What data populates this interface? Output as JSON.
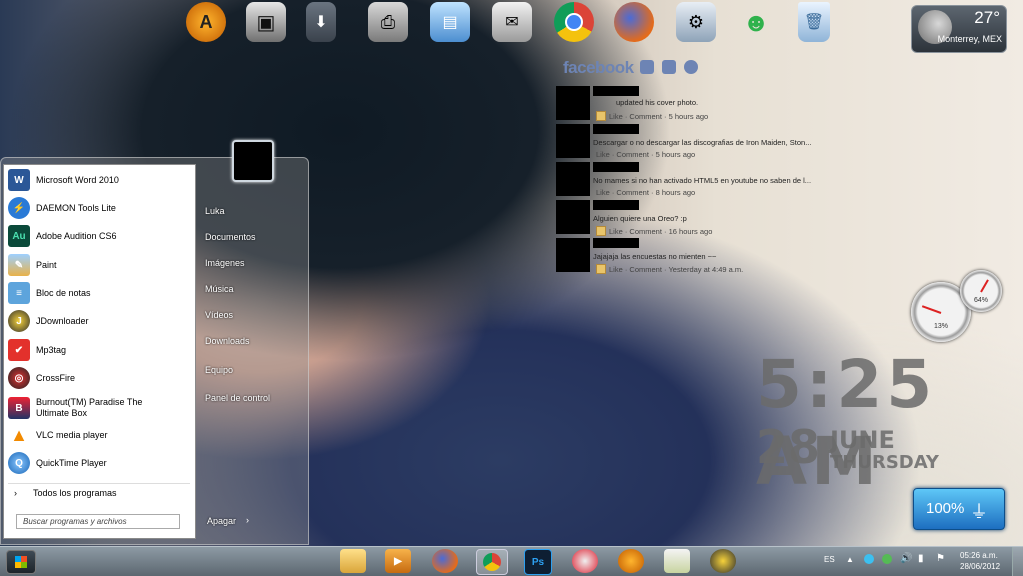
{
  "dock": {
    "icons": [
      "aimp-icon",
      "media-center-icon",
      "downloads-icon",
      "printer-icon",
      "photo-viewer-icon",
      "mail-icon",
      "chrome-icon",
      "firefox-icon",
      "control-panel-icon",
      "messenger-icon",
      "recycle-bin-icon"
    ]
  },
  "weather": {
    "temperature": "27°",
    "city": "Monterrey, MEX"
  },
  "facebook": {
    "title": "facebook",
    "feed": [
      {
        "text": "updated his cover photo.",
        "meta": "Like · Comment · 5 hours ago"
      },
      {
        "text": "Descargar o no descargar las discografias de Iron Maiden, Ston...",
        "meta": "Like · Comment · 5 hours ago"
      },
      {
        "text": "No mames si no han activado HTML5 en youtube no saben de l...",
        "meta": "Like · Comment · 8 hours ago"
      },
      {
        "text": "Alguien quiere una Oreo? :p",
        "meta": "Like · Comment · 16 hours ago"
      },
      {
        "text": "Jajajaja las encuestas no mienten ~~",
        "meta": "Like · Comment · Yesterday at 4:49 a.m."
      }
    ]
  },
  "gauges": {
    "cpu": "13%",
    "memory": "64%"
  },
  "clock": {
    "time": "5:25 AM",
    "day": "28",
    "month": "JUNE",
    "weekday": "THURSDAY"
  },
  "battery": {
    "percent": "100%"
  },
  "start_menu": {
    "programs": [
      {
        "label": "Microsoft Word 2010",
        "icon": "word-icon",
        "glyph": "W"
      },
      {
        "label": "DAEMON Tools Lite",
        "icon": "daemon-tools-icon",
        "glyph": "⚡"
      },
      {
        "label": "Adobe Audition CS6",
        "icon": "audition-icon",
        "glyph": "Au"
      },
      {
        "label": "Paint",
        "icon": "paint-icon",
        "glyph": "✎"
      },
      {
        "label": "Bloc de notas",
        "icon": "notepad-icon",
        "glyph": "≡"
      },
      {
        "label": "JDownloader",
        "icon": "jdownloader-icon",
        "glyph": "J"
      },
      {
        "label": "Mp3tag",
        "icon": "mp3tag-icon",
        "glyph": "✔"
      },
      {
        "label": "CrossFire",
        "icon": "crossfire-icon",
        "glyph": "◎"
      },
      {
        "label": "Burnout(TM) Paradise The Ultimate Box",
        "icon": "burnout-icon",
        "glyph": "B"
      },
      {
        "label": "VLC media player",
        "icon": "vlc-icon",
        "glyph": "▲"
      },
      {
        "label": "QuickTime Player",
        "icon": "quicktime-icon",
        "glyph": "Q"
      }
    ],
    "all_programs": "Todos los programas",
    "search_placeholder": "Buscar programas y archivos",
    "places": [
      "Luka",
      "Documentos",
      "Imágenes",
      "Música",
      "Vídeos",
      "Downloads",
      "Equipo",
      "Panel de control"
    ],
    "shutdown": "Apagar"
  },
  "taskbar": {
    "apps": [
      "explorer-icon",
      "media-player-icon",
      "firefox-icon",
      "chrome-icon",
      "photoshop-icon",
      "ccleaner-icon",
      "aimp-icon",
      "notepad-icon",
      "jdownloader-icon"
    ],
    "language": "ES",
    "time": "05:26 a.m.",
    "date": "28/06/2012"
  }
}
